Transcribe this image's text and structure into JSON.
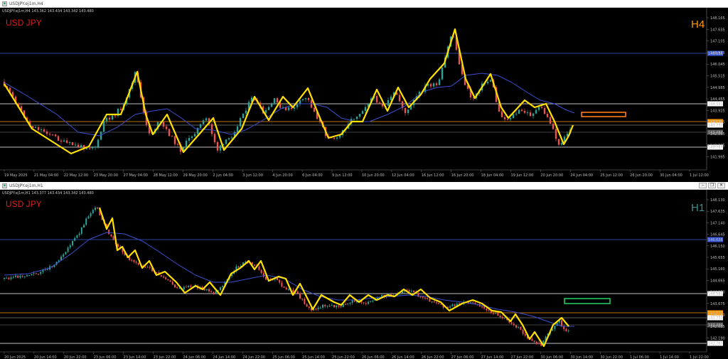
{
  "colors": {
    "bull": "#26a69a",
    "bear": "#ef5350",
    "zigzag": "#ffe000",
    "ma": "#3b4fd0",
    "orangeZone": "#ff7a1a",
    "greenZone": "#22c55e",
    "tfH4": "#ff9900",
    "tfH1": "#3a8e8e",
    "priceLevel": "#ffffff",
    "blueLevel": "#3b5bd6",
    "currentPrice": "#ff9900"
  },
  "windows": [
    {
      "key": "h4",
      "title": "USDJPY.ej1m,H4",
      "ohlc": "USDJPY.ej1m,H4  143.362 143.434 143.342 143.480",
      "symbol_label": "USD JPY",
      "timeframe_label": "H4",
      "price_labels": [
        "148.165",
        "147.635",
        "147.105",
        "146.575",
        "146.045",
        "145.515",
        "144.985",
        "144.455",
        "143.925",
        "143.395",
        "142.865",
        "142.335",
        "141.995"
      ],
      "level_labels": [
        "146.636",
        "144.591",
        "143.872",
        "143.732",
        "143.480",
        "142.767"
      ],
      "time_labels": [
        "19 May 2025",
        "21 May 04:00",
        "22 May 12:00",
        "23 May 20:00",
        "27 May 04:00",
        "28 May 12:00",
        "29 May 20:00",
        "2 Jun 04:00",
        "3 Jun 12:00",
        "4 Jun 20:00",
        "6 Jun 04:00",
        "9 Jun 12:00",
        "10 Jun 20:00",
        "12 Jun 04:00",
        "16 Jun 12:00",
        "16 Jun 20:00",
        "18 Jun 04:00",
        "19 Jun 12:00",
        "20 Jun 20:00",
        "24 Jun 04:00",
        "25 Jun 12:00",
        "26 Jun 20:00",
        "30 Jun 04:00",
        "1 Jul 12:00"
      ]
    },
    {
      "key": "h1",
      "title": "USDJPY.ej1m,H1",
      "ohlc": "USDJPY.ej1m,H1  143.377 143.434 143.342 143.480",
      "symbol_label": "USD JPY",
      "timeframe_label": "H1",
      "price_labels": [
        "148.130",
        "147.635",
        "147.140",
        "146.645",
        "146.150",
        "145.655",
        "145.160",
        "144.665",
        "144.170",
        "143.675",
        "143.180",
        "142.685",
        "142.190"
      ],
      "level_labels": [
        "146.636",
        "144.591",
        "143.872",
        "143.732",
        "143.480",
        "142.767"
      ],
      "time_labels": [
        "20 Jun 2025",
        "20 Jun 14:00",
        "20 Jun 22:00",
        "23 Jun 06:00",
        "23 Jun 14:00",
        "23 Jun 22:00",
        "24 Jun 06:00",
        "24 Jun 14:00",
        "24 Jun 22:00",
        "25 Jun 06:00",
        "25 Jun 14:00",
        "25 Jun 22:00",
        "26 Jun 06:00",
        "26 Jun 14:00",
        "26 Jun 22:00",
        "27 Jun 06:00",
        "27 Jun 14:00",
        "27 Jun 22:00",
        "30 Jun 06:00",
        "30 Jun 14:00",
        "30 Jun 22:00",
        "1 Jul 06:00",
        "1 Jul 14:00",
        "1 Jul 22:00"
      ]
    }
  ]
}
